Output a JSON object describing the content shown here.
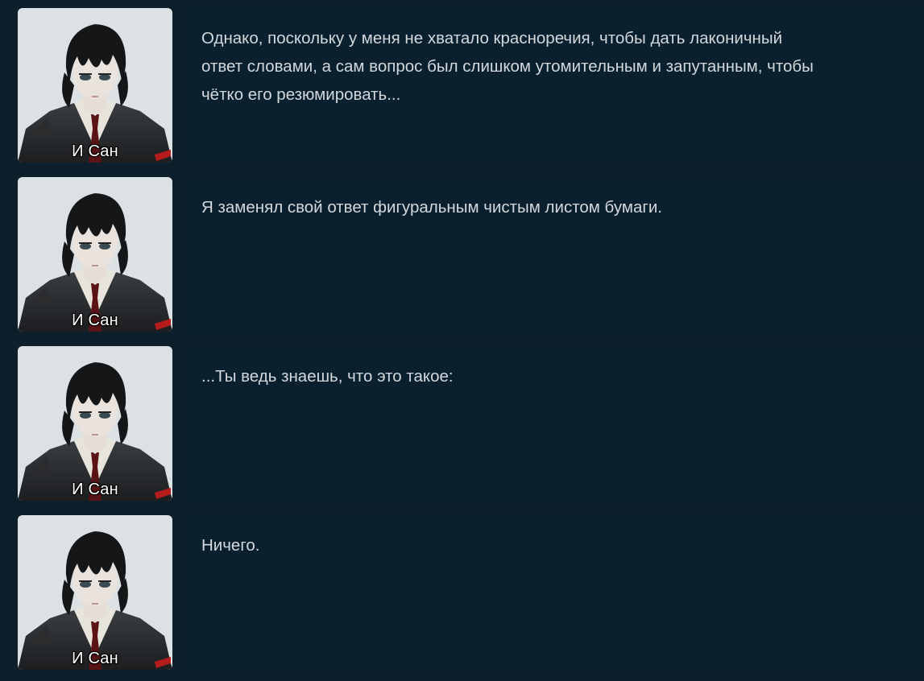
{
  "dialogue_log": {
    "entries": [
      {
        "speaker": "И Сан",
        "text": "Однако, поскольку у меня не хватало красноречия, чтобы дать лаконичный\nответ словами, а сам вопрос был слишком утомительным и запутанным, чтобы\nчётко его резюмировать..."
      },
      {
        "speaker": "И Сан",
        "text": "Я заменял свой ответ фигуральным чистым листом бумаги."
      },
      {
        "speaker": "И Сан",
        "text": "...Ты ведь знаешь, что это такое:"
      },
      {
        "speaker": "И Сан",
        "text": "Ничего."
      }
    ]
  },
  "colors": {
    "background": "#0d1f2b",
    "bubble": "#0b202e",
    "text": "#d2d8dc",
    "portrait_bg": "#cfd6d9"
  },
  "icons": {
    "portrait": "character-portrait-yi-sang"
  }
}
